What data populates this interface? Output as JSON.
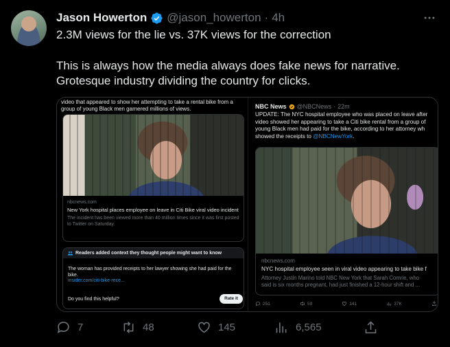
{
  "author": {
    "name": "Jason Howerton",
    "handle": "@jason_howerton",
    "separator": "·",
    "time": "4h"
  },
  "tweet": {
    "line1": "2.3M views for the lie vs. 37K views for the correction",
    "line2": "This is always how the media always does fake news for narrative.",
    "line3": "Grotesque industry dividing the country for clicks."
  },
  "left_card": {
    "caption": "video that appeared to show her attempting to take a rental bike from a group of young Black men garnered millions of views.",
    "link": {
      "source": "nbcnews.com",
      "title": "New York hospital places employee on leave in Citi Bike viral video incident",
      "description": "The incident has been viewed more than 40 million times since it was first posted to Twitter on Saturday."
    },
    "community_note": {
      "header": "Readers added context they thought people might want to know",
      "body": "The woman has provided receipts to her lawyer showing she had paid for the bike.",
      "link": "insider.com/citi-bike-rece...",
      "question": "Do you find this helpful?",
      "rate_button": "Rate it"
    }
  },
  "right_card": {
    "name": "NBC News",
    "handle": "@NBCNews",
    "separator": "·",
    "time": "22m",
    "text_line1": "UPDATE: The NYC hospital employee who was placed on leave after",
    "text_line2": "video showed her appearing to take a Citi bike rental from a group of",
    "text_line3": "young Black men had paid for the bike, according to her attorney wh",
    "text_line4_prefix": "showed the receipts to ",
    "text_mention": "@NBCNewYork",
    "text_line4_suffix": ".",
    "link": {
      "source": "nbcnews.com",
      "title": "NYC hospital employee seen in viral video appearing to take bike f",
      "description_line1": "Attorney Justin Marino told NBC New York that Sarah Comrie, who",
      "description_line2": "said is six months pregnant, had just finished a 12-hour shift and ..."
    },
    "stats": {
      "replies": "251",
      "retweets": "59",
      "likes": "141",
      "views": "37K"
    }
  },
  "actions": {
    "replies": "7",
    "retweets": "48",
    "likes": "145",
    "views": "6,565"
  },
  "colors": {
    "background": "#000000",
    "text": "#e7e9ea",
    "muted": "#71767b",
    "accent": "#1d9bf0",
    "border": "#2f3336"
  }
}
